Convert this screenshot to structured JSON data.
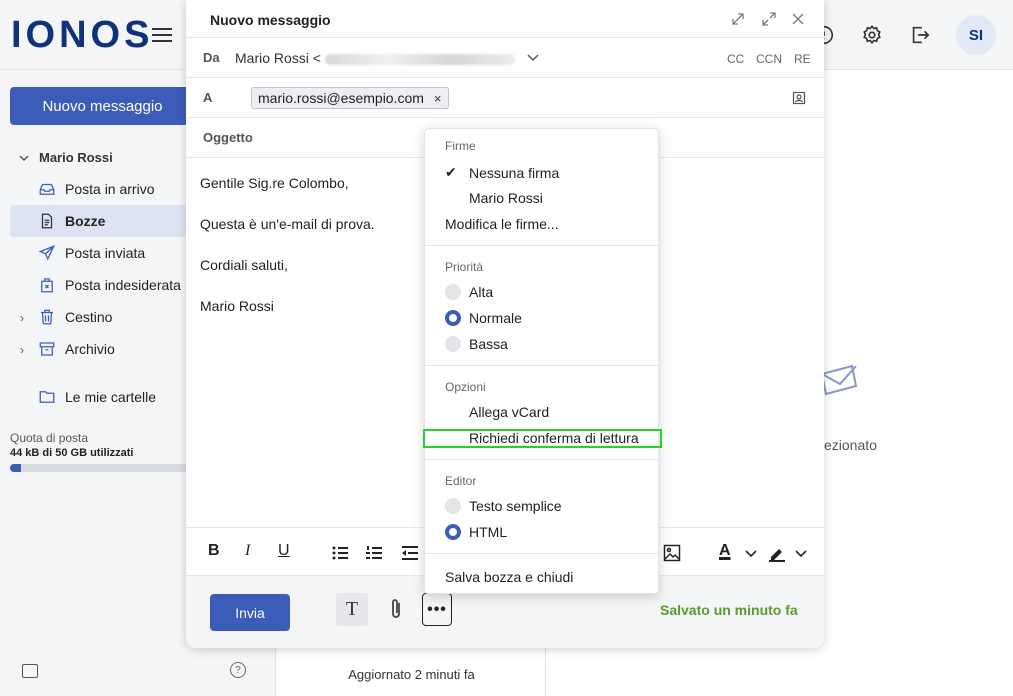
{
  "app": {
    "logo": "IONOS",
    "avatar_initials": "SI"
  },
  "sidebar": {
    "new_message": "Nuovo messaggio",
    "account": "Mario Rossi",
    "folders": [
      {
        "label": "Posta in arrivo",
        "icon": "inbox-icon"
      },
      {
        "label": "Bozze",
        "icon": "draft-icon",
        "active": true
      },
      {
        "label": "Posta inviata",
        "icon": "send-icon"
      },
      {
        "label": "Posta indesiderata",
        "icon": "spam-icon"
      },
      {
        "label": "Cestino",
        "icon": "trash-icon"
      },
      {
        "label": "Archivio",
        "icon": "archive-icon"
      },
      {
        "label": "Le mie cartelle",
        "icon": "folder-icon"
      }
    ],
    "quota_label": "Quota di posta",
    "quota_value": "44 kB di 50 GB utilizzati",
    "quota_fraction": 0.06
  },
  "list": {
    "updated": "Aggiornato 2 minuti fa"
  },
  "reading_pane": {
    "empty_text_fragment": "ezionato"
  },
  "compose": {
    "title": "Nuovo messaggio",
    "from_label": "Da",
    "from_name": "Mario Rossi <",
    "cc": "CC",
    "bcc": "CCN",
    "reply_to": "RE",
    "to_label": "A",
    "to_recipient": "mario.rossi@esempio.com",
    "chip_remove": "×",
    "subject_label": "Oggetto",
    "body": [
      "Gentile Sig.re Colombo,",
      "Questa è un'e-mail di prova.",
      "Cordiali saluti,",
      "Mario Rossi"
    ],
    "toolbar": {
      "bold": "B",
      "italic": "I",
      "underline": "U",
      "font_color": "A"
    },
    "footer": {
      "send": "Invia",
      "text_format": "T",
      "more": "•••",
      "saved": "Salvato un minuto fa"
    }
  },
  "menu": {
    "signatures_title": "Firme",
    "sig_none": "Nessuna firma",
    "sig_mario": "Mario Rossi",
    "sig_edit": "Modifica le firme...",
    "priority_title": "Priorità",
    "prio_high": "Alta",
    "prio_normal": "Normale",
    "prio_low": "Bassa",
    "options_title": "Opzioni",
    "opt_vcard": "Allega vCard",
    "opt_read_receipt": "Richiedi conferma di lettura",
    "editor_title": "Editor",
    "editor_plain": "Testo semplice",
    "editor_html": "HTML",
    "save_close": "Salva bozza e chiudi",
    "highlight_color": "#2ecc2e"
  }
}
